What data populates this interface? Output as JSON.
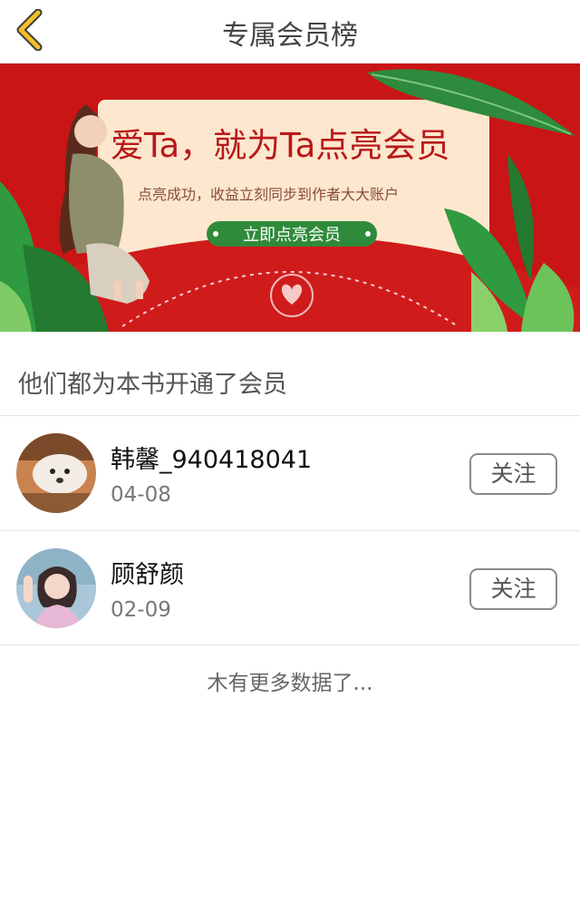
{
  "header": {
    "title": "专属会员榜",
    "back_icon": "chevron-left-icon",
    "accent": "#f3c026"
  },
  "banner": {
    "headline": "爱Ta，就为Ta点亮会员",
    "subline": "点亮成功，收益立刻同步到作者大大账户",
    "cta_label": "立即点亮会员",
    "colors": {
      "background": "#c91515",
      "card": "#fde7cf",
      "headline": "#b81919",
      "cta": "#2f8b3a"
    }
  },
  "section": {
    "title": "他们都为本书开通了会员"
  },
  "members": [
    {
      "name": "韩馨_940418041",
      "date": "04-08",
      "follow_label": "关注"
    },
    {
      "name": "顾舒颜",
      "date": "02-09",
      "follow_label": "关注"
    }
  ],
  "footer": {
    "end_text": "木有更多数据了..."
  }
}
